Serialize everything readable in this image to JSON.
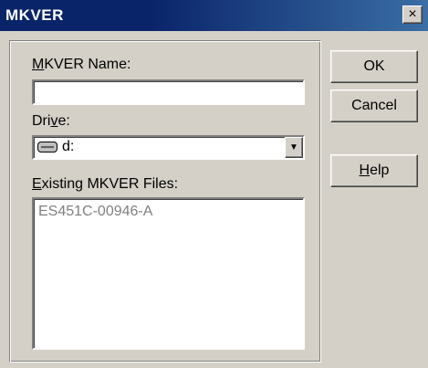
{
  "window": {
    "title": "MKVER",
    "close_glyph": "×"
  },
  "form": {
    "name_label_accel": "M",
    "name_label_rest": "KVER Name:",
    "name_value": "",
    "drive_label_pre": "Dri",
    "drive_label_accel": "v",
    "drive_label_post": "e:",
    "drive_icon": "drive-icon",
    "drive_value": "d:",
    "dropdown_glyph": "▼",
    "files_label_accel": "E",
    "files_label_rest": "xisting MKVER Files:",
    "files": [
      "ES451C-00946-A"
    ]
  },
  "buttons": {
    "ok": "OK",
    "cancel": "Cancel",
    "help_accel": "H",
    "help_rest": "elp"
  }
}
